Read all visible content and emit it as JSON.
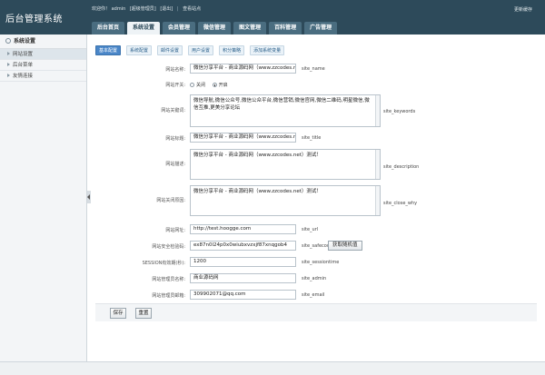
{
  "header": {
    "logo": "后台管理系统",
    "welcome": "欢迎你！ admin",
    "links": [
      "[超级管理员]",
      "[退出]"
    ],
    "view_site": "查看站点",
    "clear_cache": "更新缓存",
    "nav_tabs": [
      "后台首页",
      "系统设置",
      "会员管理",
      "微信管理",
      "图文管理",
      "百科管理",
      "广告管理"
    ]
  },
  "sidebar": {
    "title": "系统设置",
    "items": [
      "网站设置",
      "后台菜单",
      "友情连接"
    ]
  },
  "subtabs": [
    "基本配置",
    "系统配置",
    "邮件设置",
    "用户设置",
    "积分策略",
    "添加系统变量"
  ],
  "form": {
    "site_name": {
      "label": "网站名称:",
      "value": "微信分享平台 - 商业源码网（www.zzcodes.n",
      "var": "site_name"
    },
    "site_open": {
      "label": "网站开关:",
      "options": [
        "关闭",
        "开启"
      ],
      "selected": "开启"
    },
    "site_keywords": {
      "label": "网站关键词:",
      "value": "微信导航,微信公众号,微信公众平台,微信营销,微信官网,微信二维码,明星微信,微信互推,更美分享论坛",
      "var": "site_keywords"
    },
    "site_title": {
      "label": "网站标题:",
      "value": "微信分享平台 - 商业源码网（www.zzcodes.n",
      "var": "site_title"
    },
    "site_description": {
      "label": "网站描述:",
      "value": "微信分享平台 - 商业源码网（www.zzcodes.net）测试！",
      "var": "site_description"
    },
    "site_close_why": {
      "label": "网站关闭原因:",
      "value": "微信分享平台 - 商业源码网（www.zzcodes.net）测试！",
      "var": "site_close_why"
    },
    "site_url": {
      "label": "网站网址:",
      "value": "http://test.hoogge.com",
      "var": "site_url"
    },
    "site_safecode": {
      "label": "网站安全检验码:",
      "value": "ex87n0l24p0x0wiubxvzxjf87xnqgob4",
      "var": "site_safecode",
      "button": "获取随机值"
    },
    "site_sessiontime": {
      "label": "SESSION有效期(秒):",
      "value": "1200",
      "var": "site_sessiontime"
    },
    "site_admin": {
      "label": "网站管理员名称:",
      "value": "商业源码网",
      "var": "site_admin"
    },
    "site_email": {
      "label": "网站管理员邮箱:",
      "value": "309902071@qq.com",
      "var": "site_email"
    }
  },
  "actions": {
    "save": "保存",
    "reset": "重置"
  }
}
